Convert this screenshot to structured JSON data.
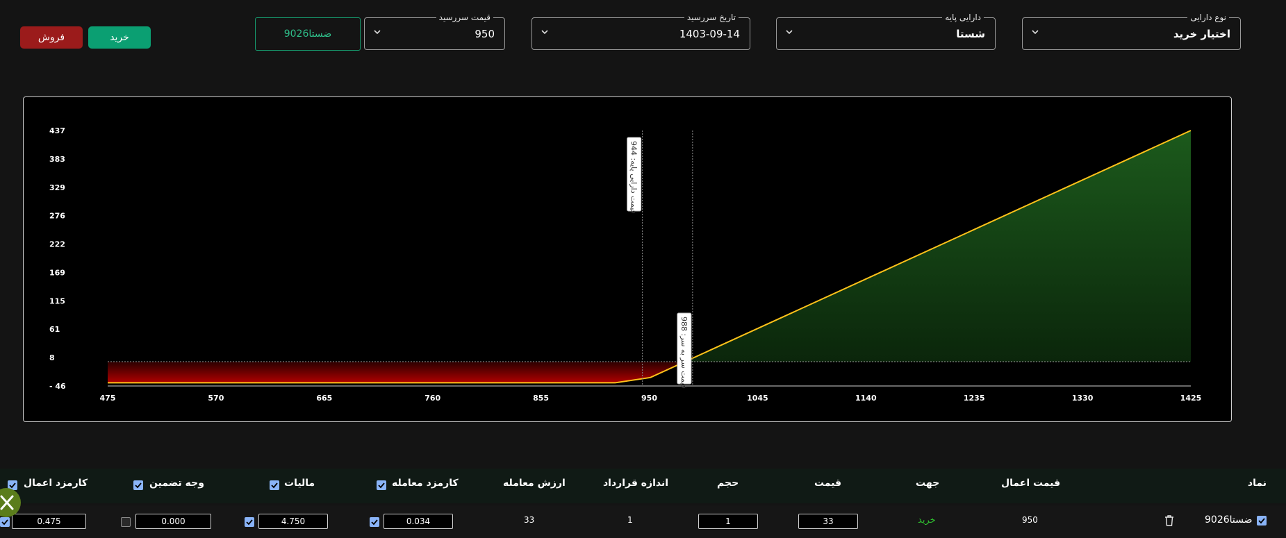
{
  "form": {
    "option_type": {
      "label": "نوع دارایی",
      "value": "اختیار خرید"
    },
    "underlying": {
      "label": "دارایی پایه",
      "value": "شستا"
    },
    "expiry": {
      "label": "تاریخ سررسید",
      "value": "1403-09-14"
    },
    "strike": {
      "label": "قیمت سررسید",
      "value": "950"
    },
    "symbol_chip": "ضستا9026",
    "buy_label": "خرید",
    "sell_label": "فروش"
  },
  "colors": {
    "buy": "#0b9f72",
    "sell": "#9b1b1b",
    "payoff_line": "#ffc21a",
    "profit_fill": "#1e5a1e",
    "loss_fill": "#a60000",
    "chip_border": "#169a6e",
    "buy_text": "#2fbf2f"
  },
  "chart_data": {
    "type": "area",
    "x": [
      475,
      920,
      951,
      1425
    ],
    "y": [
      -40,
      -40,
      -30,
      437
    ],
    "x_ticks": [
      "475",
      "570",
      "665",
      "760",
      "855",
      "950",
      "1045",
      "1140",
      "1235",
      "1330",
      "1425"
    ],
    "y_ticks": [
      "437",
      "383",
      "329",
      "276",
      "222",
      "169",
      "115",
      "61",
      "8",
      "- 46"
    ],
    "xlim": [
      475,
      1425
    ],
    "ylim": [
      -46,
      437
    ],
    "zero_line": 0,
    "annotations": [
      {
        "x": 944,
        "text": "قیمت دارایی پایه: 944"
      },
      {
        "x": 988,
        "text": "قیمت سر به سر: 988"
      }
    ],
    "grid": false
  },
  "table": {
    "headers": {
      "symbol": "نماد",
      "strike": "قیمت اعمال",
      "side": "جهت",
      "price": "قیمت",
      "volume": "حجم",
      "contract_size": "اندازه قرارداد",
      "trade_value": "ارزش معامله",
      "trade_fee": "کارمزد معامله",
      "tax": "مالیات",
      "margin": "وجه تضمین",
      "exercise_fee": "کارمزد اعمال"
    },
    "row": {
      "symbol": "ضستا9026",
      "strike": "950",
      "side": "خرید",
      "price": "33",
      "volume": "1",
      "contract_size": "1",
      "trade_value": "33",
      "trade_fee": "0.034",
      "tax": "4.750",
      "margin": "0.000",
      "exercise_fee": "0.475"
    }
  }
}
